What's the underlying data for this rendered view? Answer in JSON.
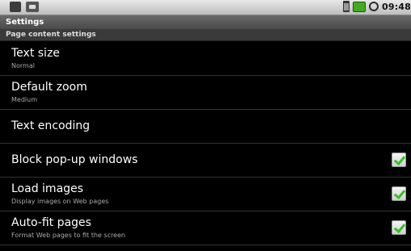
{
  "status_bar": {
    "time": "09:48",
    "icons": [
      "notification-icon",
      "usb-icon",
      "sd-card-icon",
      "battery-icon",
      "alarm-icon"
    ]
  },
  "title_bar": {
    "title": "Settings"
  },
  "section": {
    "header": "Page content settings"
  },
  "items": [
    {
      "title": "Text size",
      "summary": "Normal"
    },
    {
      "title": "Default zoom",
      "summary": "Medium"
    },
    {
      "title": "Text encoding",
      "summary": ""
    },
    {
      "title": "Block pop-up windows",
      "summary": "",
      "checked": true
    },
    {
      "title": "Load images",
      "summary": "Display images on Web pages",
      "checked": true
    },
    {
      "title": "Auto-fit pages",
      "summary": "Format Web pages to fit the screen",
      "checked": true
    }
  ],
  "colors": {
    "check": "#3bbf2a",
    "background": "#000000"
  }
}
